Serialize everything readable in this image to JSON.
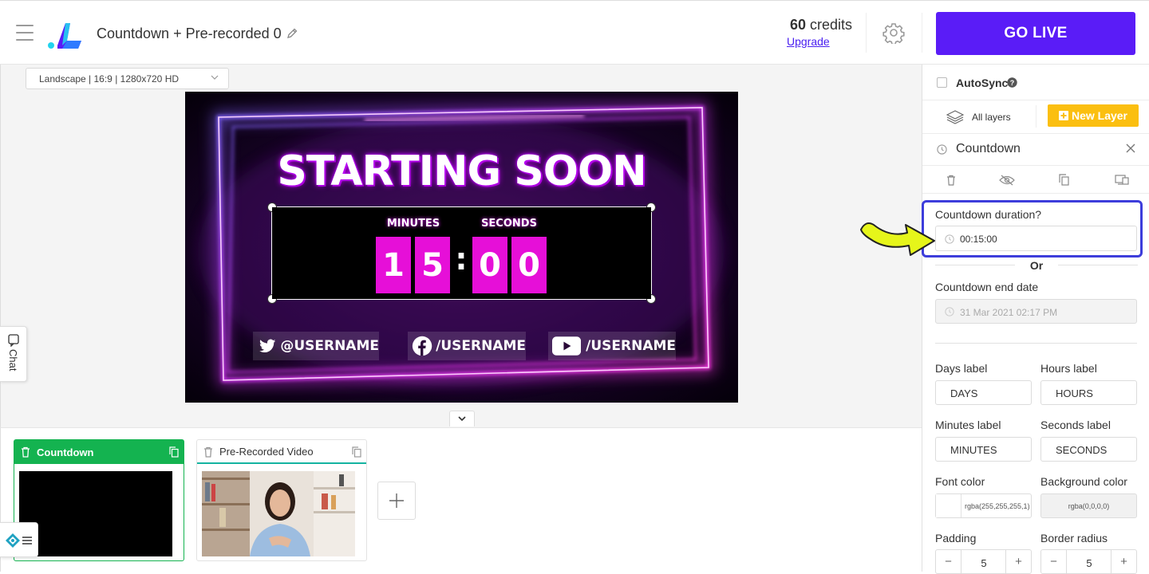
{
  "header": {
    "project_title": "Countdown + Pre-recorded 0",
    "credits_number": "60",
    "credits_label": "credits",
    "upgrade_link": "Upgrade",
    "go_live_label": "GO LIVE"
  },
  "canvas": {
    "resolution_select": "Landscape | 16:9 | 1280x720 HD",
    "overlay": {
      "headline": "STARTING SOON",
      "minutes_label": "MINUTES",
      "seconds_label": "SECONDS",
      "digits": [
        "1",
        "5",
        "0",
        "0"
      ],
      "separator": ":",
      "socials": [
        {
          "icon": "twitter-icon",
          "text": "@USERNAME"
        },
        {
          "icon": "facebook-icon",
          "text": "/USERNAME"
        },
        {
          "icon": "youtube-icon",
          "text": "/USERNAME"
        }
      ]
    },
    "chat_tab_label": "Chat"
  },
  "scenes": [
    {
      "name": "Countdown",
      "active": true
    },
    {
      "name": "Pre-Recorded Video",
      "active": false
    }
  ],
  "panel": {
    "autosync_label": "AutoSync",
    "autosync_checked": false,
    "all_layers_label": "All layers",
    "new_layer_label": "New Layer",
    "layer_title": "Countdown",
    "duration_label": "Countdown duration?",
    "duration_value": "00:15:00",
    "or_label": "Or",
    "end_date_label": "Countdown end date",
    "end_date_placeholder": "31 Mar 2021 02:17 PM",
    "days_label_title": "Days label",
    "days_label_value": "DAYS",
    "hours_label_title": "Hours label",
    "hours_label_value": "HOURS",
    "minutes_label_title": "Minutes label",
    "minutes_label_value": "MINUTES",
    "seconds_label_title": "Seconds label",
    "seconds_label_value": "SECONDS",
    "font_color_title": "Font color",
    "font_color_value": "rgba(255,255,255,1)",
    "bg_color_title": "Background color",
    "bg_color_value": "rgba(0,0,0,0)",
    "padding_title": "Padding",
    "padding_value": "5",
    "border_radius_title": "Border radius",
    "border_radius_value": "5"
  },
  "colors": {
    "go_live": "#5a1cf7",
    "new_layer": "#fbbf10",
    "active_scene": "#14b350",
    "highlight_border": "#3d3ddb",
    "digit_bg": "#e60fd8",
    "neon_pink": "#ff3cf5",
    "neon_blue": "#8c6dff"
  }
}
